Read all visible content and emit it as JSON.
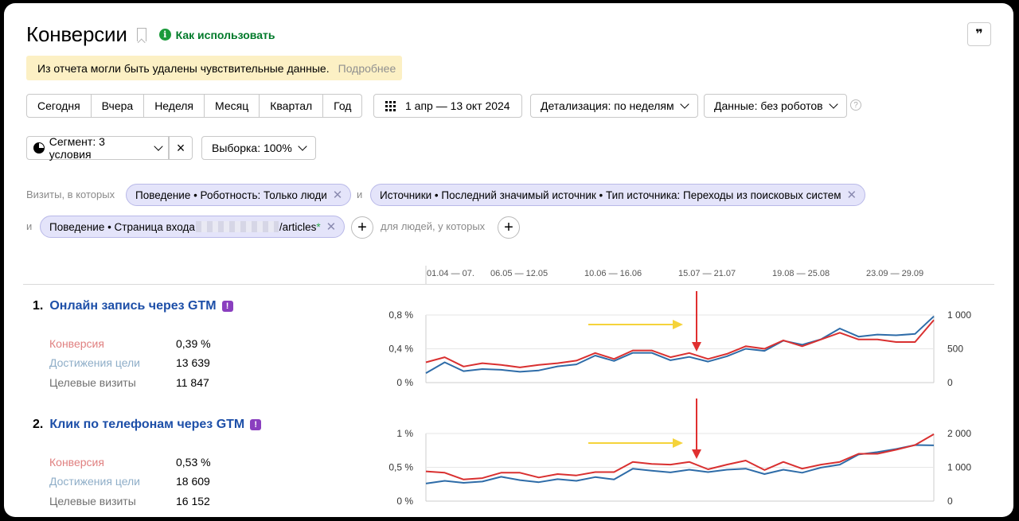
{
  "page": {
    "title": "Конверсии",
    "how_to_use": "Как использовать",
    "notice": "Из отчета могли быть удалены чувствительные данные.",
    "notice_more": "Подробнее"
  },
  "toolbar": {
    "periods": [
      "Сегодня",
      "Вчера",
      "Неделя",
      "Месяц",
      "Квартал",
      "Год"
    ],
    "date_range": "1 апр — 13 окт 2024",
    "detail": "Детализация: по неделям",
    "data": "Данные: без роботов",
    "help": "?",
    "segment": "Сегмент: 3 условия",
    "sample": "Выборка: 100%"
  },
  "filters": {
    "visits_label": "Визиты, в которых",
    "and1": "и",
    "and2": "и",
    "people_label": "для людей, у которых",
    "chip1": "Поведение • Роботность: Только люди",
    "chip2": "Источники • Последний значимый источник • Тип источника: Переходы из поисковых систем",
    "chip3_prefix": "Поведение • Страница входа",
    "chip3_suffix": "/articles",
    "chip3_mark": "*"
  },
  "timeline": {
    "labels": [
      "01.04 — 07.",
      "06.05 — 12.05",
      "10.06 — 16.06",
      "15.07 — 21.07",
      "19.08 — 25.08",
      "23.09 — 29.09"
    ]
  },
  "goals": [
    {
      "num": "1.",
      "name": "Онлайн запись через GTM",
      "conv_label": "Конверсия",
      "conv_value": "0,39 %",
      "reach_label": "Достижения цели",
      "reach_value": "13 639",
      "visits_label": "Целевые визиты",
      "visits_value": "11 847"
    },
    {
      "num": "2.",
      "name": "Клик по телефонам через GTM",
      "conv_label": "Конверсия",
      "conv_value": "0,53 %",
      "reach_label": "Достижения цели",
      "reach_value": "18 609",
      "visits_label": "Целевые визиты",
      "visits_value": "16 152"
    }
  ],
  "colors": {
    "red": "#d93030",
    "blue": "#2e6ca8",
    "arrow_yellow": "#f5d33a",
    "arrow_red": "#e03030"
  },
  "chart_data": [
    {
      "type": "line",
      "categories_count": 28,
      "left_axis": {
        "ticks": [
          "0 %",
          "0,4 %",
          "0,8 %"
        ],
        "range": [
          0,
          0.8
        ]
      },
      "right_axis": {
        "ticks": [
          "0",
          "500",
          "1 000"
        ],
        "range": [
          0,
          1000
        ]
      },
      "series": [
        {
          "axis": "left",
          "color": "red",
          "values": [
            0.24,
            0.3,
            0.19,
            0.23,
            0.21,
            0.18,
            0.21,
            0.23,
            0.26,
            0.35,
            0.28,
            0.38,
            0.38,
            0.3,
            0.35,
            0.28,
            0.34,
            0.43,
            0.4,
            0.5,
            0.43,
            0.51,
            0.59,
            0.51,
            0.51,
            0.48,
            0.48,
            0.74
          ]
        },
        {
          "axis": "right",
          "color": "blue",
          "values": [
            140,
            300,
            170,
            200,
            190,
            160,
            180,
            240,
            270,
            400,
            320,
            440,
            440,
            330,
            380,
            310,
            390,
            500,
            470,
            620,
            560,
            640,
            800,
            680,
            710,
            700,
            720,
            980
          ]
        }
      ]
    },
    {
      "type": "line",
      "categories_count": 28,
      "left_axis": {
        "ticks": [
          "0 %",
          "0,5 %",
          "1 %"
        ],
        "range": [
          0,
          1
        ]
      },
      "right_axis": {
        "ticks": [
          "0",
          "1 000",
          "2 000"
        ],
        "range": [
          0,
          2000
        ]
      },
      "series": [
        {
          "axis": "left",
          "color": "red",
          "values": [
            0.44,
            0.42,
            0.32,
            0.34,
            0.42,
            0.42,
            0.35,
            0.4,
            0.38,
            0.43,
            0.43,
            0.58,
            0.55,
            0.54,
            0.58,
            0.47,
            0.54,
            0.6,
            0.46,
            0.58,
            0.48,
            0.54,
            0.58,
            0.7,
            0.7,
            0.76,
            0.83,
            0.99
          ]
        },
        {
          "axis": "right",
          "color": "blue",
          "values": [
            520,
            600,
            540,
            580,
            720,
            620,
            560,
            650,
            600,
            710,
            640,
            960,
            900,
            850,
            930,
            860,
            930,
            960,
            800,
            930,
            840,
            990,
            1080,
            1380,
            1450,
            1540,
            1660,
            1650
          ]
        }
      ]
    }
  ]
}
